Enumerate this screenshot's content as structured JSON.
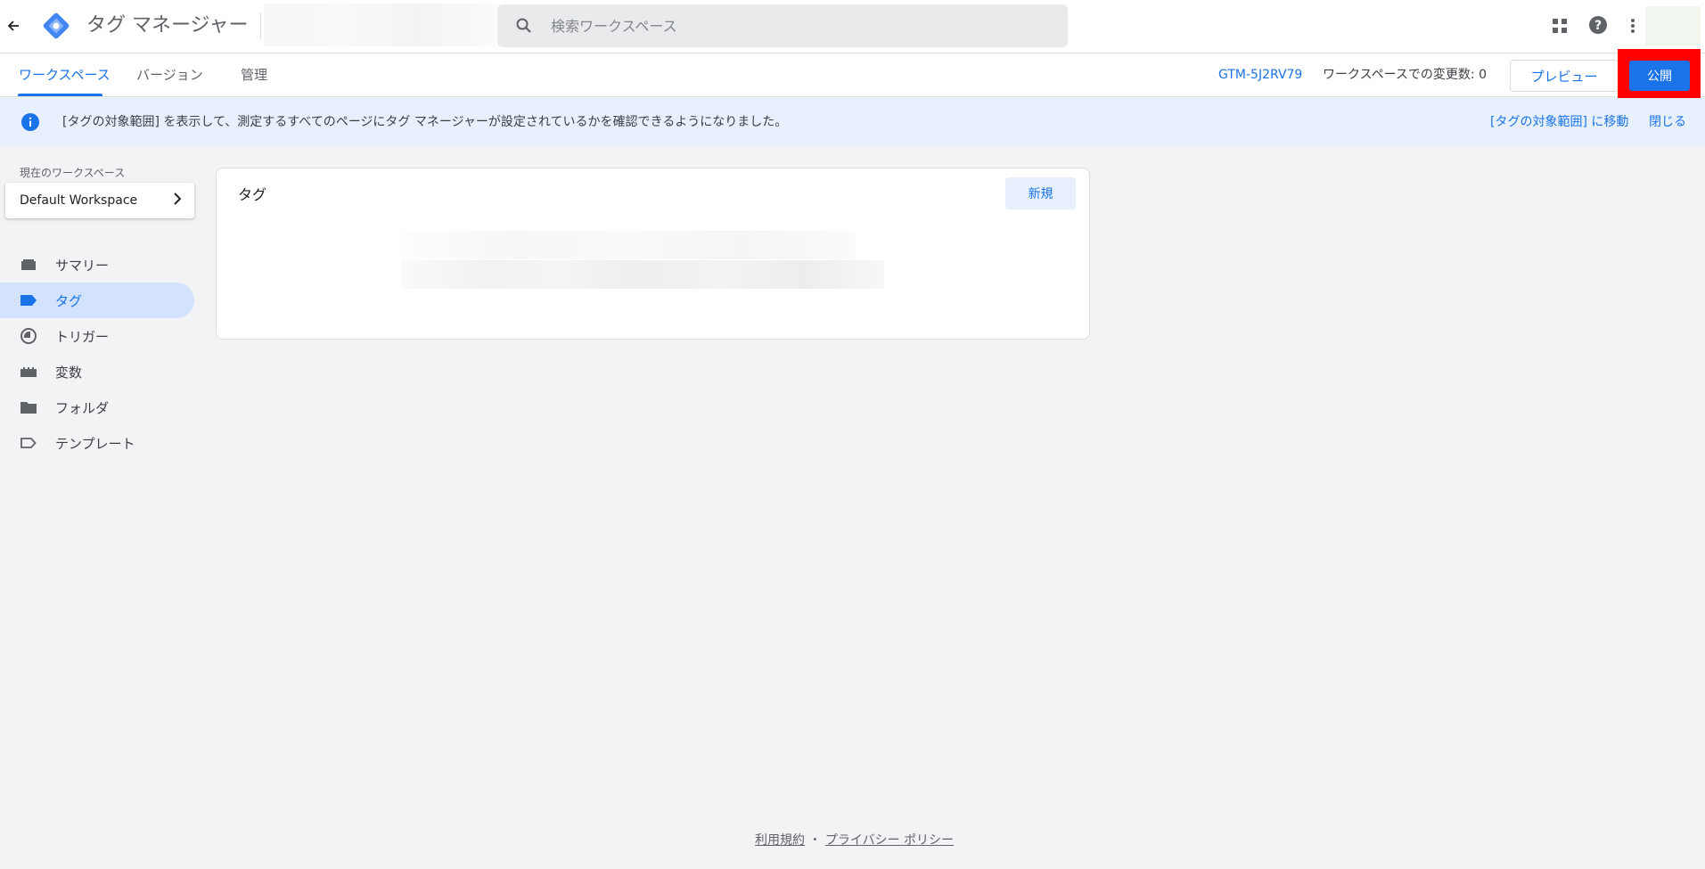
{
  "header": {
    "app_title": "タグ マネージャー",
    "search_placeholder": "検索ワークスペース"
  },
  "subnav": {
    "tabs": [
      {
        "label": "ワークスペース",
        "active": true
      },
      {
        "label": "バージョン",
        "active": false
      },
      {
        "label": "管理",
        "active": false
      }
    ],
    "container_id": "GTM-5J2RV79",
    "changes_text": "ワークスペースでの変更数: 0",
    "preview_label": "プレビュー",
    "publish_label": "公開"
  },
  "banner": {
    "message": "[タグの対象範囲] を表示して、測定するすべてのページにタグ マネージャーが設定されているかを確認できるようになりました。",
    "link_label": "[タグの対象範囲] に移動",
    "close_label": "閉じる"
  },
  "sidebar": {
    "workspace_label": "現在のワークスペース",
    "workspace_name": "Default Workspace",
    "items": [
      {
        "label": "サマリー",
        "icon": "summary-icon",
        "active": false
      },
      {
        "label": "タグ",
        "icon": "tag-icon",
        "active": true
      },
      {
        "label": "トリガー",
        "icon": "trigger-icon",
        "active": false
      },
      {
        "label": "変数",
        "icon": "variable-icon",
        "active": false
      },
      {
        "label": "フォルダ",
        "icon": "folder-icon",
        "active": false
      },
      {
        "label": "テンプレート",
        "icon": "template-icon",
        "active": false
      }
    ]
  },
  "main": {
    "card_title": "タグ",
    "new_label": "新規"
  },
  "footer": {
    "terms": "利用規約",
    "separator": "・",
    "privacy": "プライバシー ポリシー"
  },
  "colors": {
    "accent": "#1a73e8",
    "highlight": "#ff0000",
    "banner_bg": "#e8f0fe",
    "active_nav_bg": "#d3e3fd"
  }
}
